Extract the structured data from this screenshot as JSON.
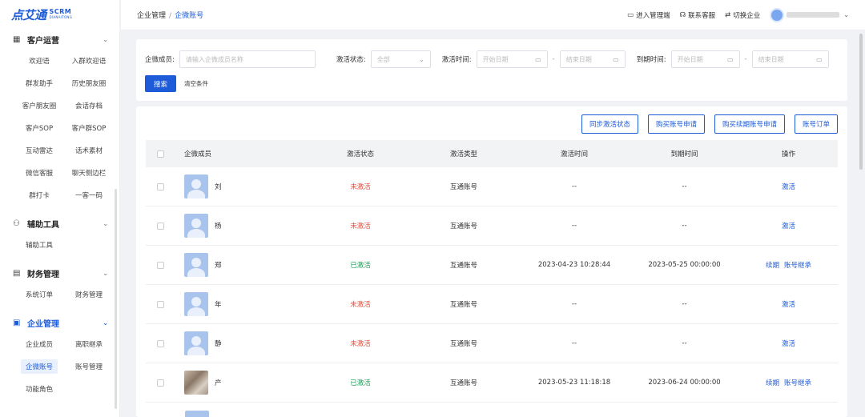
{
  "logo": {
    "mark": "点艾通",
    "scrm": "SCRM",
    "tagline": "DIANAITONG"
  },
  "sidebar": {
    "groups": [
      {
        "title": "客户运营",
        "icon": "grid-icon",
        "active": false,
        "items": [
          "欢迎语",
          "入群欢迎语",
          "群发助手",
          "历史朋友圈",
          "客户朋友圈",
          "会话存档",
          "客户SOP",
          "客户群SOP",
          "互动雷达",
          "话术素材",
          "微信客服",
          "聊天侧边栏",
          "群打卡",
          "一客一码"
        ]
      },
      {
        "title": "辅助工具",
        "icon": "users-icon",
        "active": false,
        "items": [
          "辅助工具"
        ]
      },
      {
        "title": "财务管理",
        "icon": "ledger-icon",
        "active": false,
        "items": [
          "系统订单",
          "财务管理"
        ]
      },
      {
        "title": "企业管理",
        "icon": "enterprise-icon",
        "active": true,
        "items": [
          "企业成员",
          "离职继承",
          "企微账号",
          "账号管理",
          "功能角色"
        ]
      }
    ],
    "active_item": "企微账号"
  },
  "header": {
    "breadcrumb": [
      "企业管理",
      "企微账号"
    ],
    "actions": {
      "admin": "进入管理端",
      "support": "联系客服",
      "switch": "切换企业"
    }
  },
  "filter": {
    "member_label": "企微成员:",
    "member_placeholder": "请输入企微成员名称",
    "status_label": "激活状态:",
    "status_value": "全部",
    "activate_time_label": "激活时间:",
    "expire_time_label": "到期时间:",
    "start_placeholder": "开始日期",
    "end_placeholder": "结束日期",
    "search": "搜索",
    "clear": "清空条件"
  },
  "toolbar": {
    "sync": "同步激活状态",
    "buy": "购买账号申请",
    "renew": "购买续期账号申请",
    "orders": "账号订单"
  },
  "table": {
    "columns": [
      "企微成员",
      "激活状态",
      "激活类型",
      "激活时间",
      "到期时间",
      "操作"
    ],
    "rows": [
      {
        "name": "刘",
        "status": "未激活",
        "status_color": "#e34d3b",
        "type": "互通账号",
        "activated": "--",
        "expires": "--",
        "ops": [
          "激活"
        ],
        "avatar": "default"
      },
      {
        "name": "杨",
        "status": "未激活",
        "status_color": "#e34d3b",
        "type": "互通账号",
        "activated": "--",
        "expires": "--",
        "ops": [
          "激活"
        ],
        "avatar": "default"
      },
      {
        "name": "郑",
        "status": "已激活",
        "status_color": "#18a058",
        "type": "互通账号",
        "activated": "2023-04-23 10:28:44",
        "expires": "2023-05-25 00:00:00",
        "ops": [
          "续期",
          "账号继承"
        ],
        "avatar": "default"
      },
      {
        "name": "年",
        "status": "未激活",
        "status_color": "#e34d3b",
        "type": "互通账号",
        "activated": "--",
        "expires": "--",
        "ops": [
          "激活"
        ],
        "avatar": "default"
      },
      {
        "name": "静",
        "status": "未激活",
        "status_color": "#e34d3b",
        "type": "互通账号",
        "activated": "--",
        "expires": "--",
        "ops": [
          "激活"
        ],
        "avatar": "default"
      },
      {
        "name": "产",
        "status": "已激活",
        "status_color": "#18a058",
        "type": "互通账号",
        "activated": "2023-05-23 11:18:18",
        "expires": "2023-06-24 00:00:00",
        "ops": [
          "续期",
          "账号继承"
        ],
        "avatar": "photo"
      }
    ]
  },
  "colors": {
    "primary": "#1e5bd8",
    "inactive": "#e34d3b",
    "active": "#18a058"
  }
}
